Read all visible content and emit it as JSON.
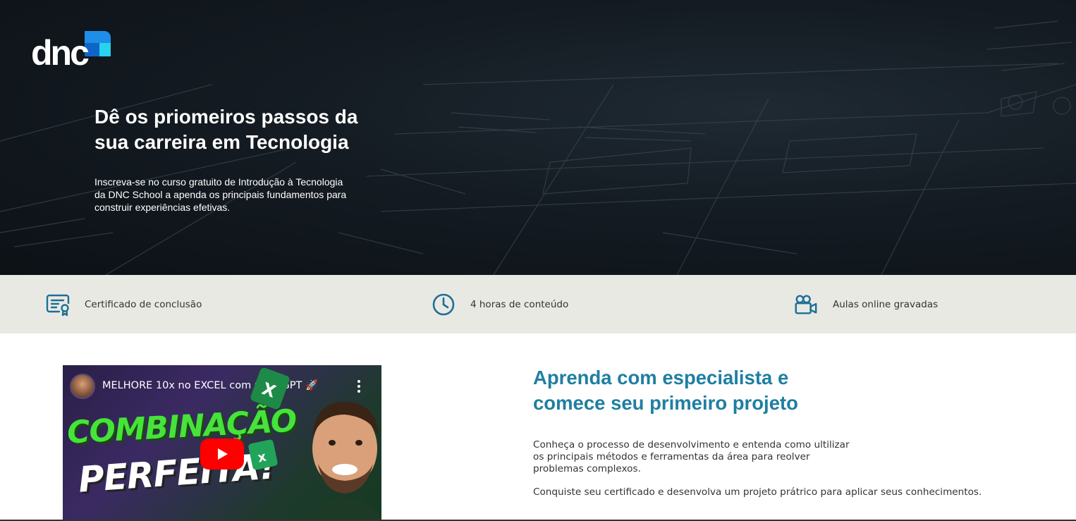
{
  "brand": {
    "logo_text": "dnc"
  },
  "hero": {
    "title": "Dê os priomeiros passos da sua carreira em Tecnologia",
    "subtitle": "Inscreva-se no curso gratuito de Introdução à Tecnologia da DNC School a apenda os principais fundamentos para construir experiências efetivas."
  },
  "features": [
    {
      "icon": "certificate-icon",
      "label": "Certificado de conclusão"
    },
    {
      "icon": "clock-icon",
      "label": "4 horas de conteúdo"
    },
    {
      "icon": "video-camera-icon",
      "label": "Aulas online gravadas"
    }
  ],
  "video": {
    "title": "MELHORE 10x no EXCEL com CHATGPT 🚀",
    "thumb_line1": "COMBINAÇÃO",
    "thumb_line2": "PERFEITA!"
  },
  "learn": {
    "title": "Aprenda com especialista e comece seu primeiro projeto",
    "paragraph1": "Conheça o processo de desenvolvimento e entenda como ultilizar os principais métodos e ferramentas da área para reolver problemas complexos.",
    "paragraph2": "Conquiste seu certificado e desenvolva um projeto prátrico para aplicar seus conhecimentos."
  },
  "colors": {
    "accent": "#1f7fa1",
    "feature_bar": "#e9e9e4",
    "hero_bg": "#141b22",
    "youtube_red": "#ff0000"
  }
}
